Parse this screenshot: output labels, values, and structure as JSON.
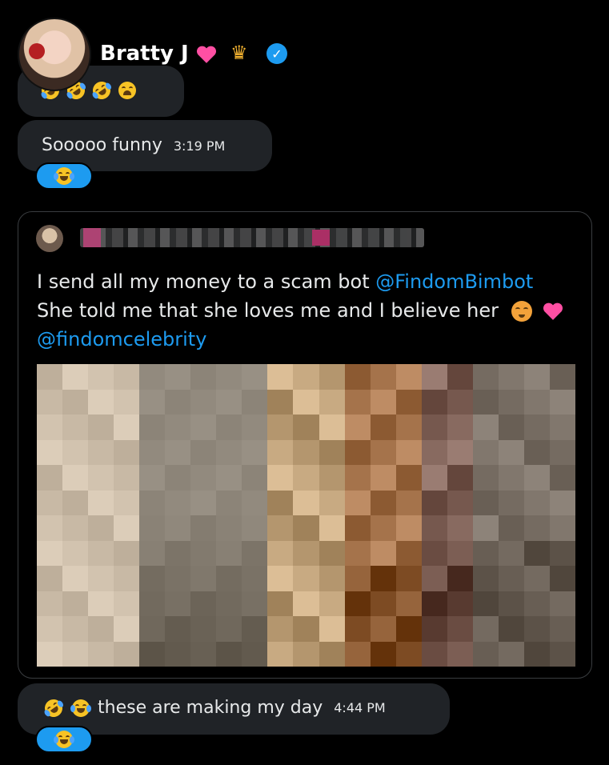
{
  "header": {
    "name": "Bratty J",
    "avatar_icon": "profile-avatar",
    "badges": [
      "pink-heart-icon",
      "crown-icon",
      "verified-badge-icon"
    ]
  },
  "messages": [
    {
      "id": "m1",
      "text": "",
      "emojis": [
        "rofl-icon",
        "rofl-icon",
        "rofl-icon",
        "weary-face-icon"
      ]
    },
    {
      "id": "m2",
      "text": "Sooooo funny",
      "time": "3:19 PM",
      "reaction": "tears-of-joy-icon"
    },
    {
      "id": "m3",
      "text": "these are making my day",
      "time": "4:44 PM",
      "leading_emojis": [
        "rofl-icon",
        "tears-of-joy-icon"
      ],
      "reaction": "tears-of-joy-icon"
    }
  ],
  "quote_tweet": {
    "line1": "I send all my money to a scam bot ",
    "mention1": "@FindomBimbot",
    "line2": "She told me that she loves me and I believe her",
    "line2_emojis": [
      "pleading-face-icon",
      "pink-heart-icon"
    ],
    "mention2": "@findomcelebrity",
    "image_icon": "pixelated-image"
  },
  "colors": {
    "accent": "#1d9bf0",
    "bubble": "#202327",
    "background": "#000000"
  }
}
